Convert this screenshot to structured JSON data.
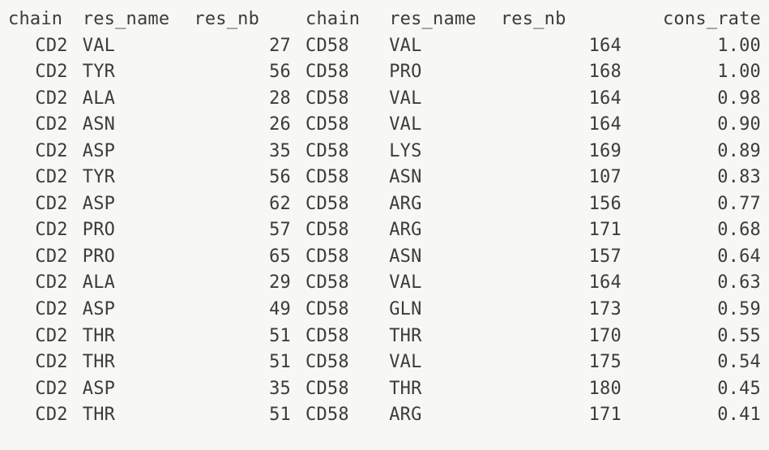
{
  "headers": {
    "chain1": "chain",
    "res_name1": "res_name",
    "res_nb1": "res_nb",
    "chain2": "chain",
    "res_name2": "res_name",
    "res_nb2": "res_nb",
    "cons_rate": "cons_rate"
  },
  "rows": [
    {
      "chain1": "CD2",
      "res_name1": "VAL",
      "res_nb1": "27",
      "chain2": "CD58",
      "res_name2": "VAL",
      "res_nb2": "164",
      "cons_rate": "1.00"
    },
    {
      "chain1": "CD2",
      "res_name1": "TYR",
      "res_nb1": "56",
      "chain2": "CD58",
      "res_name2": "PRO",
      "res_nb2": "168",
      "cons_rate": "1.00"
    },
    {
      "chain1": "CD2",
      "res_name1": "ALA",
      "res_nb1": "28",
      "chain2": "CD58",
      "res_name2": "VAL",
      "res_nb2": "164",
      "cons_rate": "0.98"
    },
    {
      "chain1": "CD2",
      "res_name1": "ASN",
      "res_nb1": "26",
      "chain2": "CD58",
      "res_name2": "VAL",
      "res_nb2": "164",
      "cons_rate": "0.90"
    },
    {
      "chain1": "CD2",
      "res_name1": "ASP",
      "res_nb1": "35",
      "chain2": "CD58",
      "res_name2": "LYS",
      "res_nb2": "169",
      "cons_rate": "0.89"
    },
    {
      "chain1": "CD2",
      "res_name1": "TYR",
      "res_nb1": "56",
      "chain2": "CD58",
      "res_name2": "ASN",
      "res_nb2": "107",
      "cons_rate": "0.83"
    },
    {
      "chain1": "CD2",
      "res_name1": "ASP",
      "res_nb1": "62",
      "chain2": "CD58",
      "res_name2": "ARG",
      "res_nb2": "156",
      "cons_rate": "0.77"
    },
    {
      "chain1": "CD2",
      "res_name1": "PRO",
      "res_nb1": "57",
      "chain2": "CD58",
      "res_name2": "ARG",
      "res_nb2": "171",
      "cons_rate": "0.68"
    },
    {
      "chain1": "CD2",
      "res_name1": "PRO",
      "res_nb1": "65",
      "chain2": "CD58",
      "res_name2": "ASN",
      "res_nb2": "157",
      "cons_rate": "0.64"
    },
    {
      "chain1": "CD2",
      "res_name1": "ALA",
      "res_nb1": "29",
      "chain2": "CD58",
      "res_name2": "VAL",
      "res_nb2": "164",
      "cons_rate": "0.63"
    },
    {
      "chain1": "CD2",
      "res_name1": "ASP",
      "res_nb1": "49",
      "chain2": "CD58",
      "res_name2": "GLN",
      "res_nb2": "173",
      "cons_rate": "0.59"
    },
    {
      "chain1": "CD2",
      "res_name1": "THR",
      "res_nb1": "51",
      "chain2": "CD58",
      "res_name2": "THR",
      "res_nb2": "170",
      "cons_rate": "0.55"
    },
    {
      "chain1": "CD2",
      "res_name1": "THR",
      "res_nb1": "51",
      "chain2": "CD58",
      "res_name2": "VAL",
      "res_nb2": "175",
      "cons_rate": "0.54"
    },
    {
      "chain1": "CD2",
      "res_name1": "ASP",
      "res_nb1": "35",
      "chain2": "CD58",
      "res_name2": "THR",
      "res_nb2": "180",
      "cons_rate": "0.45"
    },
    {
      "chain1": "CD2",
      "res_name1": "THR",
      "res_nb1": "51",
      "chain2": "CD58",
      "res_name2": "ARG",
      "res_nb2": "171",
      "cons_rate": "0.41"
    }
  ]
}
